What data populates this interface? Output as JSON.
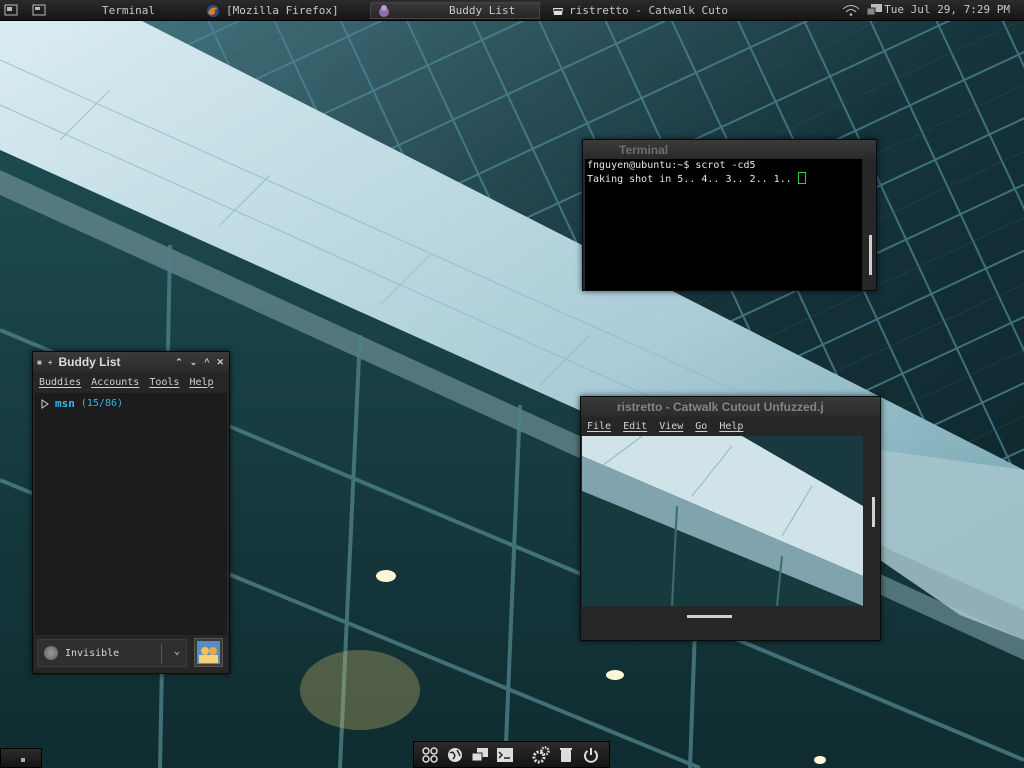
{
  "panel": {
    "tasks": [
      {
        "label": "Terminal"
      },
      {
        "label": "[Mozilla Firefox]"
      },
      {
        "label": "Buddy List"
      },
      {
        "label": "ristretto - Catwalk Cutou..."
      }
    ],
    "clock": "Tue Jul 29, 7:29 PM"
  },
  "terminal": {
    "title": "Terminal",
    "lines": [
      "fnguyen@ubuntu:~$ scrot -cd5",
      "Taking shot in 5.. 4.. 3.. 2.. 1.. "
    ]
  },
  "buddy_list": {
    "title": "Buddy List",
    "menu": [
      "Buddies",
      "Accounts",
      "Tools",
      "Help"
    ],
    "group": {
      "name": "msn",
      "count": "(15/86)"
    },
    "status": "Invisible"
  },
  "ristretto": {
    "title": "ristretto - Catwalk Cutout Unfuzzed.j",
    "menu": [
      "File",
      "Edit",
      "View",
      "Go",
      "Help"
    ]
  },
  "colors": {
    "accent": "#35b6e8",
    "cursor": "#27d34a"
  },
  "launcher": {
    "icons": [
      "apps-icon",
      "globe-icon",
      "windows-icon",
      "terminal-icon",
      "settings-icon",
      "trash-icon",
      "power-icon"
    ]
  }
}
